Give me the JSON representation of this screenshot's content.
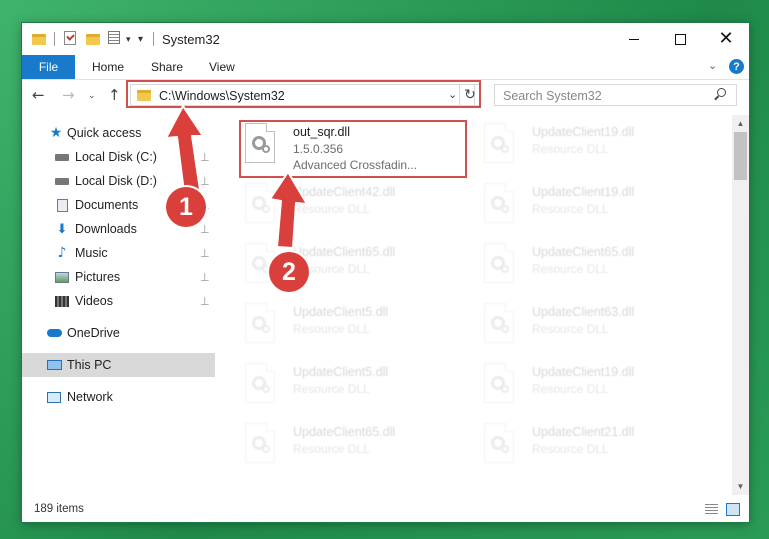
{
  "window": {
    "title": "System32",
    "qa_dropdown": "▾",
    "qa_separator_glyph": "|",
    "min_glyph": "",
    "max_glyph": "",
    "close_glyph": "✕"
  },
  "ribbon": {
    "tabs": [
      "File",
      "Home",
      "Share",
      "View"
    ],
    "collapse_glyph": "⌄",
    "help_glyph": "?"
  },
  "nav": {
    "back_glyph": "←",
    "forward_glyph": "→",
    "recent_glyph": "⌄",
    "up_glyph": "↑",
    "address": "C:\\Windows\\System32",
    "address_dropdown_glyph": "⌄",
    "refresh_glyph": "↻",
    "search_placeholder": "Search System32"
  },
  "sidebar": {
    "items": [
      {
        "label": "Quick access",
        "icon": "star-icon"
      },
      {
        "label": "Local Disk (C:)",
        "icon": "drive-icon",
        "pinned": true
      },
      {
        "label": "Local Disk (D:)",
        "icon": "drive-icon",
        "pinned": true
      },
      {
        "label": "Documents",
        "icon": "documents-icon",
        "pinned": true
      },
      {
        "label": "Downloads",
        "icon": "download-icon",
        "pinned": true
      },
      {
        "label": "Music",
        "icon": "music-icon",
        "pinned": true
      },
      {
        "label": "Pictures",
        "icon": "pictures-icon",
        "pinned": true
      },
      {
        "label": "Videos",
        "icon": "videos-icon",
        "pinned": true
      },
      {
        "label": "OneDrive",
        "icon": "onedrive-icon"
      },
      {
        "label": "This PC",
        "icon": "pc-icon",
        "selected": true
      },
      {
        "label": "Network",
        "icon": "network-icon"
      }
    ],
    "pin_glyph": "📌"
  },
  "files": [
    {
      "name": "out_sqr.dll",
      "version": "1.5.0.356",
      "description": "Advanced Crossfadin...",
      "highlighted": true
    },
    {
      "name": "UpdateClient19.dll",
      "version": "Resource DLL"
    },
    {
      "name": "UpdateClient42.dll",
      "version": "Resource DLL"
    },
    {
      "name": "UpdateClient19.dll",
      "version": "Resource DLL"
    },
    {
      "name": "UpdateClient65.dll",
      "version": "Resource DLL"
    },
    {
      "name": "UpdateClient65.dll",
      "version": "Resource DLL"
    },
    {
      "name": "UpdateClient5.dll",
      "version": "Resource DLL"
    },
    {
      "name": "UpdateClient63.dll",
      "version": "Resource DLL"
    },
    {
      "name": "UpdateClient5.dll",
      "version": "Resource DLL"
    },
    {
      "name": "UpdateClient19.dll",
      "version": "Resource DLL"
    },
    {
      "name": "UpdateClient65.dll",
      "version": "Resource DLL"
    },
    {
      "name": "UpdateClient21.dll",
      "version": "Resource DLL"
    }
  ],
  "status": {
    "item_count": "189 items"
  },
  "annotations": {
    "marker1": "1",
    "marker2": "2",
    "color": "#d9403b"
  },
  "colors": {
    "accent": "#1979ca",
    "highlight": "#d0504f",
    "desktop": "#2f9e5a"
  }
}
